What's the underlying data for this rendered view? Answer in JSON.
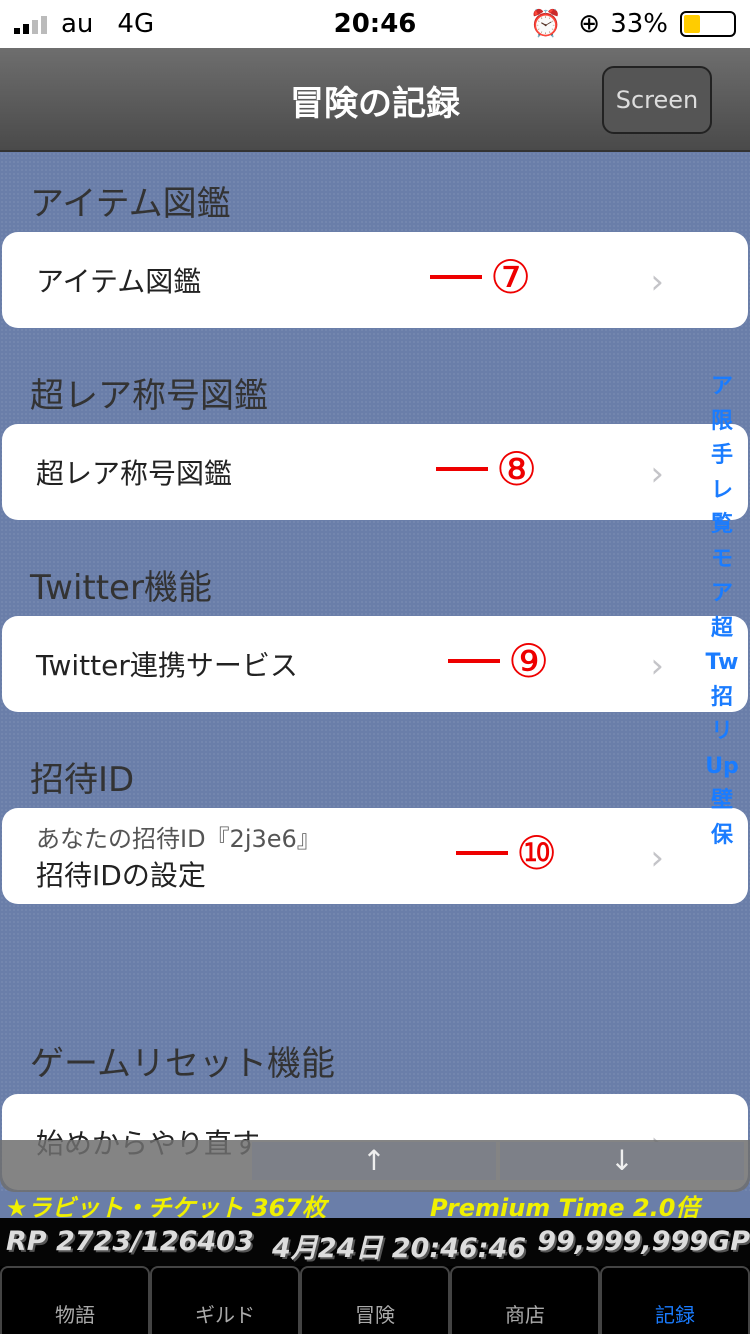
{
  "status": {
    "carrier": "au",
    "network": "4G",
    "time": "20:46",
    "battery": "33%"
  },
  "nav": {
    "title": "冒険の記録",
    "screen_button": "Screen"
  },
  "sections": [
    {
      "header": "アイテム図鑑",
      "cell": "アイテム図鑑",
      "mark": "⑦"
    },
    {
      "header": "超レア称号図鑑",
      "cell": "超レア称号図鑑",
      "mark": "⑧"
    },
    {
      "header": "Twitter機能",
      "cell": "Twitter連携サービス",
      "mark": "⑨"
    },
    {
      "header": "招待ID",
      "subtitle": "あなたの招待ID『2j3e6』",
      "cell": "招待IDの設定",
      "mark": "⑩"
    },
    {
      "header": "ゲームリセット機能",
      "cell": "始めからやり直す"
    }
  ],
  "index": [
    "ア",
    "限",
    "手",
    "レ",
    "覧",
    "モ",
    "ア",
    "超",
    "Tw",
    "招",
    "リ",
    "Up",
    "壁",
    "保"
  ],
  "scroll": {
    "up": "↑",
    "down": "↓"
  },
  "ticket": {
    "left": "★ラビット・チケット 367枚",
    "right": "Premium Time 2.0倍"
  },
  "info": {
    "rp": "RP 2723/126403",
    "date": "4月24日 20:46:46",
    "gp": "99,999,999GP"
  },
  "tabs": [
    "物語",
    "ギルド",
    "冒険",
    "商店",
    "記録"
  ],
  "active_tab": "記録",
  "colors": {
    "accent": "#1a7cff",
    "annotation": "#e00000",
    "ticket": "#f0f000"
  }
}
